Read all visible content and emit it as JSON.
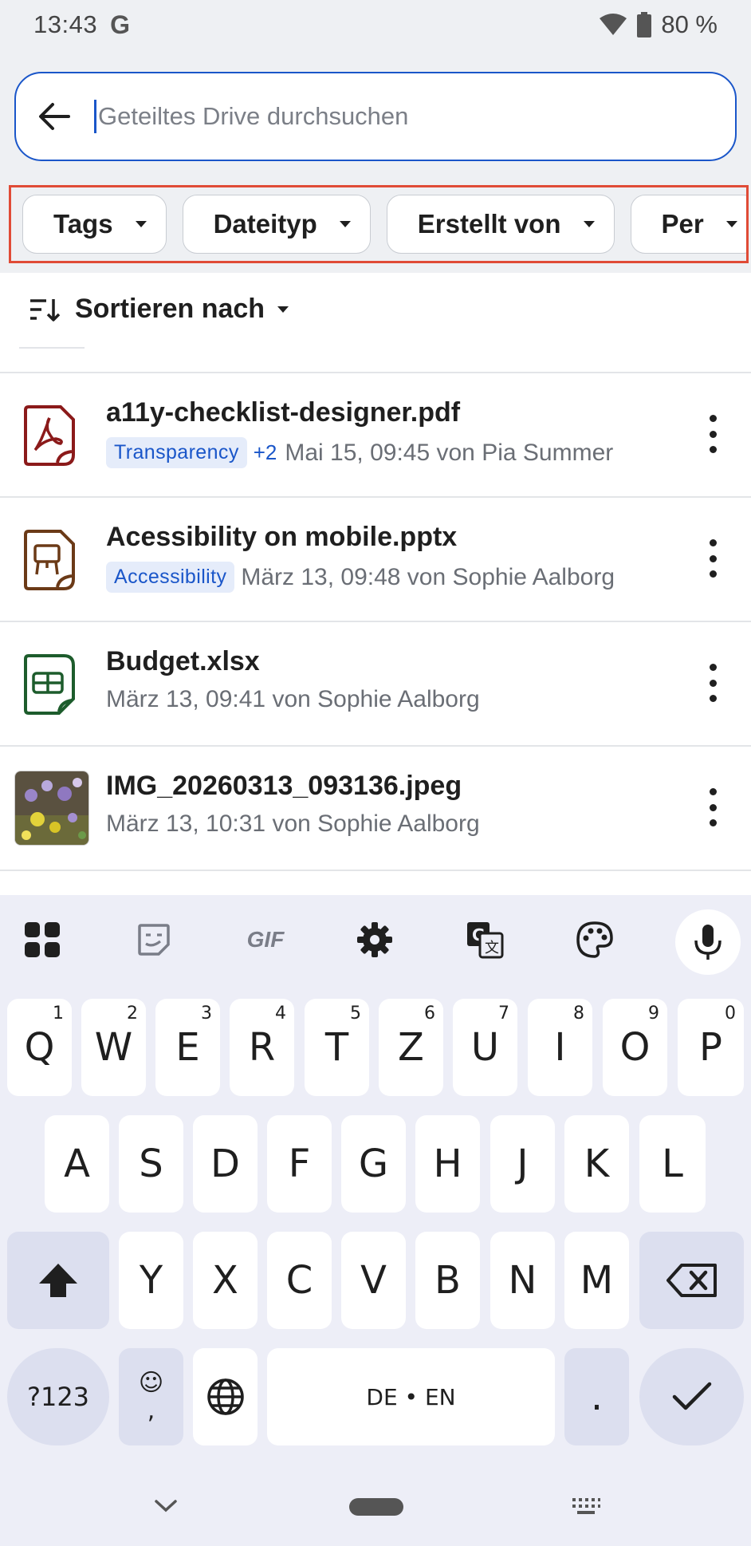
{
  "status_bar": {
    "time": "13:43",
    "g_logo": "G",
    "battery": "80 %",
    "icons": [
      "wifi-icon",
      "battery-icon"
    ]
  },
  "search": {
    "placeholder": "Geteiltes Drive durchsuchen",
    "back_icon": "arrow-back-icon"
  },
  "filters": {
    "chips": [
      "Tags",
      "Dateityp",
      "Erstellt von",
      "Per"
    ],
    "highlight_color": "#e04b36"
  },
  "sort": {
    "label": "Sortieren nach",
    "icon": "sort-icon"
  },
  "files": [
    {
      "name": "a11y-checklist-designer.pdf",
      "icon": "pdf-icon",
      "tag": "Transparency",
      "tag_more": "+2",
      "meta": "Mai 15, 09:45 von Pia Summer"
    },
    {
      "name": "Acessibility on mobile.pptx",
      "icon": "presentation-icon",
      "tag": "Accessibility",
      "meta": "März 13, 09:48 von Sophie Aalborg"
    },
    {
      "name": "Budget.xlsx",
      "icon": "spreadsheet-icon",
      "meta": "März 13, 09:41 von Sophie Aalborg"
    },
    {
      "name": "IMG_20260313_093136.jpeg",
      "icon": "image-thumbnail",
      "meta": "März 13, 10:31 von Sophie Aalborg"
    }
  ],
  "keyboard": {
    "toolbar": [
      "apps-grid-icon",
      "sticker-icon",
      "gif-icon",
      "settings-gear-icon",
      "translate-icon",
      "palette-icon",
      "microphone-icon"
    ],
    "gif_label": "GIF",
    "row1": [
      {
        "key": "Q",
        "sup": "1"
      },
      {
        "key": "W",
        "sup": "2"
      },
      {
        "key": "E",
        "sup": "3"
      },
      {
        "key": "R",
        "sup": "4"
      },
      {
        "key": "T",
        "sup": "5"
      },
      {
        "key": "Z",
        "sup": "6"
      },
      {
        "key": "U",
        "sup": "7"
      },
      {
        "key": "I",
        "sup": "8"
      },
      {
        "key": "O",
        "sup": "9"
      },
      {
        "key": "P",
        "sup": "0"
      }
    ],
    "row2": [
      "A",
      "S",
      "D",
      "F",
      "G",
      "H",
      "J",
      "K",
      "L"
    ],
    "row3": [
      "Y",
      "X",
      "C",
      "V",
      "B",
      "N",
      "M"
    ],
    "symbols_label": "?123",
    "emoji_label": "☺",
    "comma_label": ",",
    "space_label": "DE • EN",
    "period_label": "."
  },
  "accent_color": "#1a56c9"
}
